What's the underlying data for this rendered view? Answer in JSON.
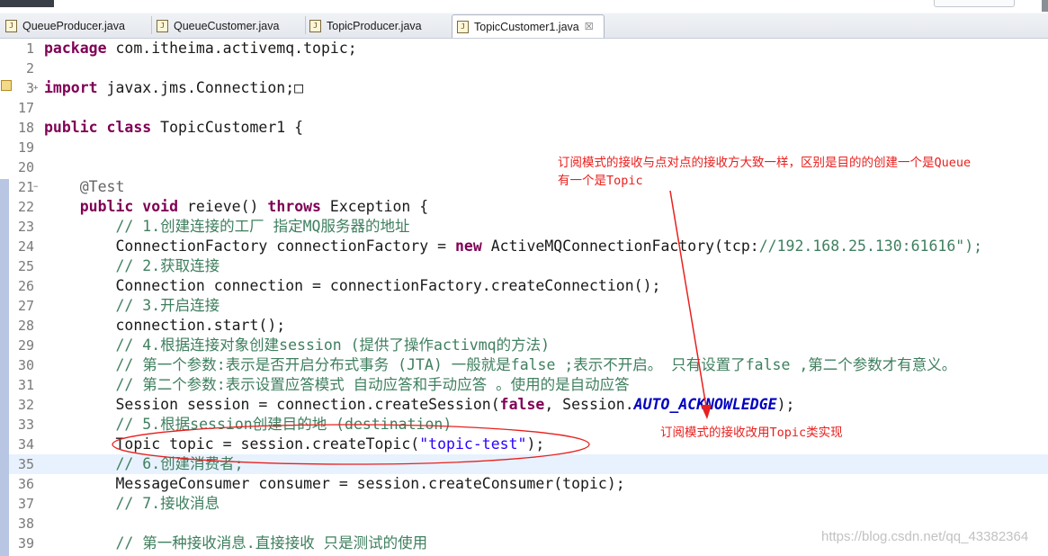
{
  "tabs": [
    {
      "label": "QueueProducer.java",
      "active": false,
      "icon": "java-file-icon"
    },
    {
      "label": "QueueCustomer.java",
      "active": false,
      "icon": "java-file-icon"
    },
    {
      "label": "TopicProducer.java",
      "active": false,
      "icon": "java-file-icon"
    },
    {
      "label": "TopicCustomer1.java",
      "active": true,
      "icon": "java-file-icon",
      "close": "☒"
    }
  ],
  "editor": {
    "lines": [
      {
        "n": "1",
        "text": "package com.itheima.activemq.topic;"
      },
      {
        "n": "2",
        "text": ""
      },
      {
        "n": "3",
        "text": "import javax.jms.Connection;□",
        "fold": "+"
      },
      {
        "n": "17",
        "text": ""
      },
      {
        "n": "18",
        "text": "public class TopicCustomer1 {"
      },
      {
        "n": "19",
        "text": ""
      },
      {
        "n": "20",
        "text": ""
      },
      {
        "n": "21",
        "text": "    @Test",
        "fold": "−"
      },
      {
        "n": "22",
        "text": "    public void reieve() throws Exception {"
      },
      {
        "n": "23",
        "text": "        // 1.创建连接的工厂 指定MQ服务器的地址"
      },
      {
        "n": "24",
        "text": "        ConnectionFactory connectionFactory = new ActiveMQConnectionFactory(\"tcp://192.168.25.130:61616\");"
      },
      {
        "n": "25",
        "text": "        // 2.获取连接"
      },
      {
        "n": "26",
        "text": "        Connection connection = connectionFactory.createConnection();"
      },
      {
        "n": "27",
        "text": "        // 3.开启连接"
      },
      {
        "n": "28",
        "text": "        connection.start();"
      },
      {
        "n": "29",
        "text": "        // 4.根据连接对象创建session (提供了操作activmq的方法)"
      },
      {
        "n": "30",
        "text": "        // 第一个参数:表示是否开启分布式事务 (JTA) 一般就是false ;表示不开启。 只有设置了false ,第二个参数才有意义。"
      },
      {
        "n": "31",
        "text": "        // 第二个参数:表示设置应答模式 自动应答和手动应答 。使用的是自动应答"
      },
      {
        "n": "32",
        "text": "        Session session = connection.createSession(false, Session.AUTO_ACKNOWLEDGE);"
      },
      {
        "n": "33",
        "text": "        // 5.根据session创建目的地 (destination)"
      },
      {
        "n": "34",
        "text": "        Topic topic = session.createTopic(\"topic-test\");"
      },
      {
        "n": "35",
        "text": "        // 6.创建消费者;",
        "highlight": true
      },
      {
        "n": "36",
        "text": "        MessageConsumer consumer = session.createConsumer(topic);"
      },
      {
        "n": "37",
        "text": "        // 7.接收消息"
      },
      {
        "n": "38",
        "text": ""
      },
      {
        "n": "39",
        "text": "        // 第一种接收消息.直接接收 只是测试的使用"
      }
    ]
  },
  "annotations": {
    "note1_line1": "订阅模式的接收与点对点的接收方大致一样，区别是目的的创建一个是Queue",
    "note1_line2": "有一个是Topic",
    "note2": "订阅模式的接收改用Topic类实现",
    "color": "#e8201e"
  },
  "watermark": "https://blog.csdn.net/qq_43382364"
}
